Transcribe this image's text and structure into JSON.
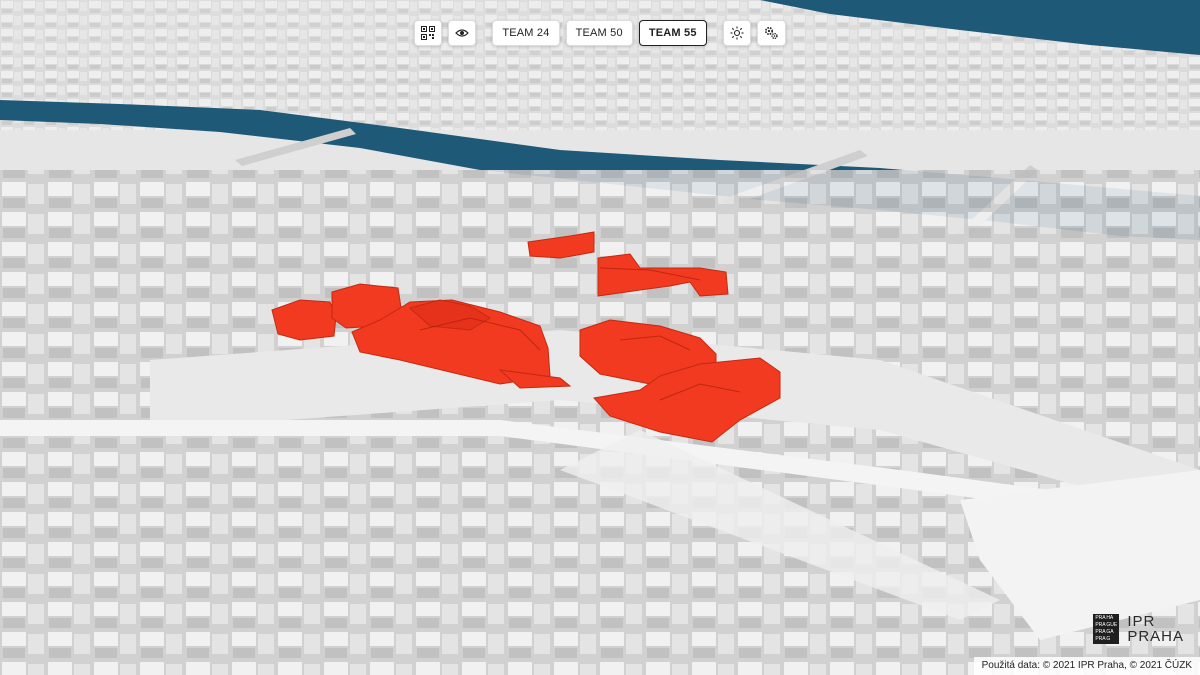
{
  "toolbar": {
    "teams": [
      {
        "label": "TEAM 24",
        "active": false
      },
      {
        "label": "TEAM 50",
        "active": false
      },
      {
        "label": "TEAM 55",
        "active": true
      }
    ],
    "icons": [
      "qr-code-icon",
      "eye-icon",
      "sun-icon",
      "settings-gears-icon"
    ]
  },
  "logo": {
    "mark_lines": [
      "PRA",
      "HA",
      "PRA",
      "GUE",
      "PRA",
      "GA",
      "PRA",
      "G"
    ],
    "line1": "IPR",
    "line2": "PRAHA"
  },
  "attribution": "Použitá data: © 2021 IPR Praha, © 2021 ČÚZK",
  "colors": {
    "highlight": "#f13a1f",
    "river": "#1e5a78",
    "ground": "#f0f0f0",
    "building": "#d6d6d6"
  }
}
